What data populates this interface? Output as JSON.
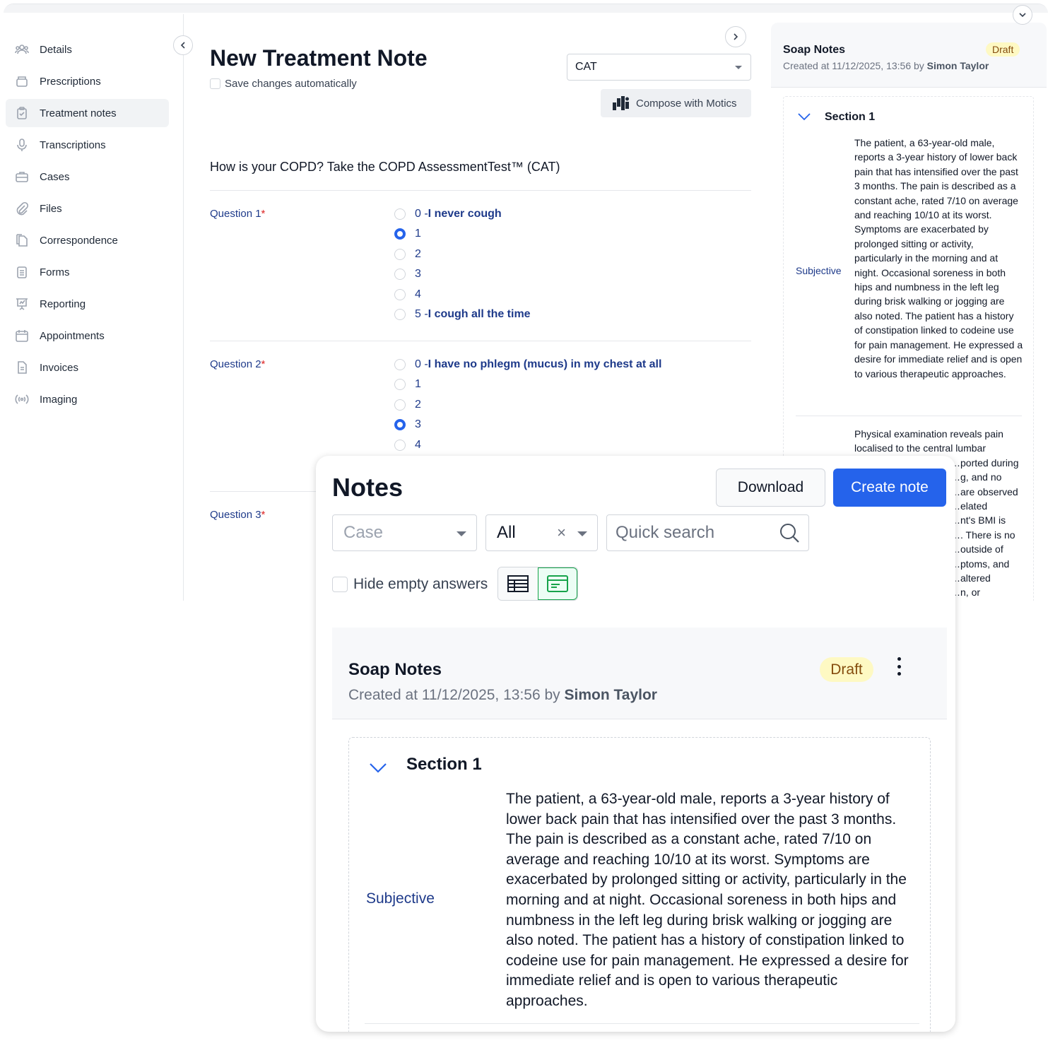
{
  "sidebar": {
    "items": [
      {
        "label": "Details",
        "icon": "users-icon"
      },
      {
        "label": "Prescriptions",
        "icon": "pill-box-icon"
      },
      {
        "label": "Treatment notes",
        "icon": "clipboard-check-icon",
        "active": true
      },
      {
        "label": "Transcriptions",
        "icon": "microphone-icon"
      },
      {
        "label": "Cases",
        "icon": "briefcase-icon"
      },
      {
        "label": "Files",
        "icon": "paperclip-icon"
      },
      {
        "label": "Correspondence",
        "icon": "documents-icon"
      },
      {
        "label": "Forms",
        "icon": "form-list-icon"
      },
      {
        "label": "Reporting",
        "icon": "presentation-chart-icon"
      },
      {
        "label": "Appointments",
        "icon": "calendar-icon"
      },
      {
        "label": "Invoices",
        "icon": "invoice-icon"
      },
      {
        "label": "Imaging",
        "icon": "broadcast-icon"
      }
    ]
  },
  "main": {
    "title": "New Treatment Note",
    "autosave_label": "Save changes automatically",
    "template_select": "CAT",
    "compose_label": "Compose with Motics",
    "question_heading": "How is your COPD? Take the COPD AssessmentTest™ (CAT)",
    "questions": [
      {
        "label": "Question 1",
        "required": "*",
        "options": [
          {
            "prefix": "0 - ",
            "text": "I never cough",
            "selected": false
          },
          {
            "prefix": "1",
            "text": "",
            "selected": true
          },
          {
            "prefix": "2",
            "text": "",
            "selected": false
          },
          {
            "prefix": "3",
            "text": "",
            "selected": false
          },
          {
            "prefix": "4",
            "text": "",
            "selected": false
          },
          {
            "prefix": "5 - ",
            "text": "I cough all the time",
            "selected": false
          }
        ]
      },
      {
        "label": "Question 2",
        "required": "*",
        "options": [
          {
            "prefix": "0 - ",
            "text": "I have no phlegm (mucus) in my chest at all",
            "selected": false
          },
          {
            "prefix": "1",
            "text": "",
            "selected": false
          },
          {
            "prefix": "2",
            "text": "",
            "selected": false
          },
          {
            "prefix": "3",
            "text": "",
            "selected": true
          },
          {
            "prefix": "4",
            "text": "",
            "selected": false
          }
        ]
      },
      {
        "label": "Question 3",
        "required": "*",
        "options": []
      }
    ]
  },
  "right_panel": {
    "title": "Soap Notes",
    "status": "Draft",
    "created_prefix": "Created at 11/12/2025, 13:56 by ",
    "created_by": "Simon Taylor",
    "section_title": "Section 1",
    "subjective_label": "Subjective",
    "subjective_text": "The patient, a 63-year-old male, reports a 3-year history of lower back pain that has intensified over the past 3 months. The pain is described as a constant ache, rated 7/10 on average and reaching 10/10 at its worst. Symptoms are exacerbated by prolonged sitting or activity, particularly in the morning and at night. Occasional soreness in both hips and numbness in the left leg during brisk walking or jogging are also noted. The patient has a history of constipation linked to codeine use for pain management. He expressed a desire for immediate relief and is open to various therapeutic approaches.",
    "objective_text_lines": [
      "Physical examination reveals pain",
      "localised to the central lumbar",
      "…ported during",
      "…g, and no",
      "…are observed",
      "…elated",
      "…nt's BMI is",
      "…. There is no",
      "…outside of",
      "…ptoms, and",
      "…altered",
      "…n, or"
    ]
  },
  "popup": {
    "title": "Notes",
    "download_label": "Download",
    "create_label": "Create note",
    "case_placeholder": "Case",
    "filter_value": "All",
    "clear_symbol": "×",
    "search_placeholder": "Quick search",
    "hide_empty_label": "Hide empty answers",
    "view_modes": [
      {
        "icon": "table-view-icon",
        "active": false
      },
      {
        "icon": "card-view-icon",
        "active": true
      }
    ],
    "card": {
      "title": "Soap Notes",
      "status": "Draft",
      "created_prefix": "Created at 11/12/2025, 13:56 by ",
      "created_by": "Simon Taylor",
      "section_title": "Section 1",
      "subjective_label": "Subjective",
      "subjective_text": "The patient, a 63-year-old male, reports a 3-year history of lower back pain that has intensified over the past 3 months. The pain is described as a constant ache, rated 7/10 on average and reaching 10/10 at its worst. Symptoms are exacerbated by prolonged sitting or activity, particularly in the morning and at night. Occasional soreness in both hips and numbness in the left leg during brisk walking or jogging are also noted. The patient has a history of constipation linked to codeine use for pain management. He expressed a desire for immediate relief and is open to various therapeutic approaches."
    }
  },
  "colors": {
    "accent": "#2563eb",
    "label_blue": "#1e3a8a",
    "required": "#dc2626",
    "draft_bg": "#fef9c3",
    "draft_text": "#854d0e",
    "active_toggle": "#16a34a"
  }
}
